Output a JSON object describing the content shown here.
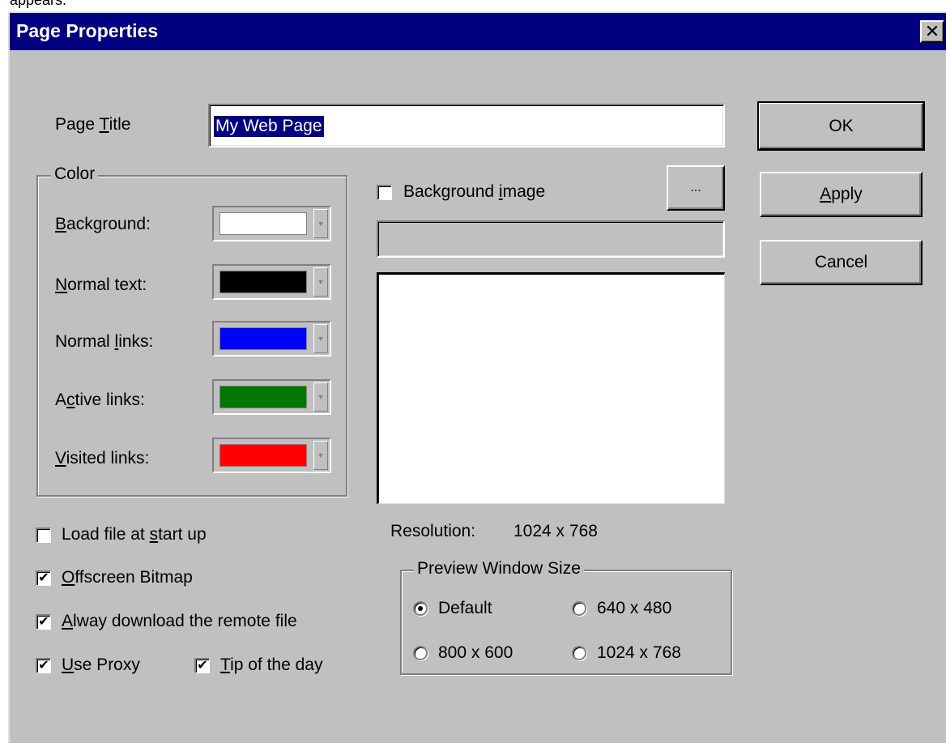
{
  "top_fragment": "appears.",
  "window": {
    "title": "Page Properties",
    "close_glyph": "✕"
  },
  "page_title": {
    "label_pre": "Page ",
    "label_mnemonic": "T",
    "label_post": "itle",
    "value": "My Web Page"
  },
  "color_group": {
    "legend": "Color",
    "rows": [
      {
        "mnemonic": "B",
        "rest": "ackground:",
        "pre": "",
        "color": "#ffffff"
      },
      {
        "mnemonic": "N",
        "rest": "ormal text:",
        "pre": "",
        "color": "#000000"
      },
      {
        "pre": "Normal ",
        "mnemonic": "l",
        "rest": "inks:",
        "color": "#0000ff"
      },
      {
        "pre": "A",
        "mnemonic": "c",
        "rest": "tive links:",
        "color": "#007800"
      },
      {
        "pre": "",
        "mnemonic": "V",
        "rest": "isited links:",
        "color": "#ff0000"
      }
    ]
  },
  "background_image": {
    "pre": "Background ",
    "mnemonic": "i",
    "post": "mage",
    "checked": false,
    "browse_label": "..."
  },
  "resolution": {
    "label": "Resolution:",
    "value": "1024 x 768"
  },
  "preview_group": {
    "legend": "Preview Window Size",
    "options": [
      {
        "label": "Default",
        "selected": true
      },
      {
        "label": "640 x 480",
        "selected": false
      },
      {
        "label": "800 x 600",
        "selected": false
      },
      {
        "label": "1024 x 768",
        "selected": false
      }
    ]
  },
  "checks": {
    "load_file": {
      "pre": "Load file at ",
      "mnemonic": "s",
      "post": "tart up",
      "checked": false
    },
    "offscreen": {
      "pre": "",
      "mnemonic": "O",
      "post": "ffscreen Bitmap",
      "checked": true
    },
    "always_download": {
      "pre": "",
      "mnemonic": "A",
      "post": "lway download the remote file",
      "checked": true
    },
    "use_proxy": {
      "pre": "",
      "mnemonic": "U",
      "post": "se Proxy",
      "checked": true
    },
    "tip_of_day": {
      "pre": "",
      "mnemonic": "T",
      "post": "ip of the day",
      "checked": true
    }
  },
  "buttons": {
    "ok": "OK",
    "apply_mnemonic": "A",
    "apply_rest": "pply",
    "cancel": "Cancel"
  },
  "check_glyph": "✔"
}
